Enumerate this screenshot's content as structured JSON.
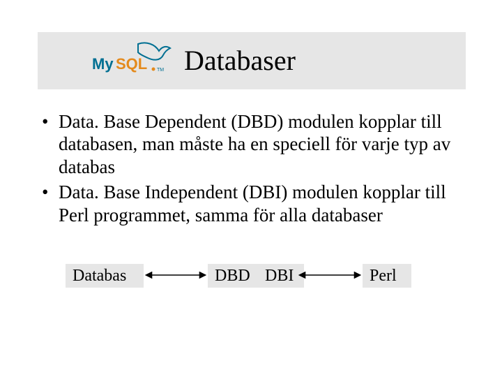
{
  "header": {
    "title": "Databaser",
    "logo_name": "mysql-logo"
  },
  "bullets": [
    "Data. Base Dependent (DBD) modulen kopplar till databasen, man måste ha en speciell för varje typ av databas",
    "Data. Base Independent (DBI) modulen kopplar till Perl programmet, samma för alla databaser"
  ],
  "diagram": {
    "databas": "Databas",
    "dbd": "DBD",
    "dbi": "DBI",
    "perl": "Perl"
  },
  "colors": {
    "box_bg": "#e6e6e6",
    "mysql_blue": "#006f92",
    "mysql_orange": "#e48a1c"
  }
}
